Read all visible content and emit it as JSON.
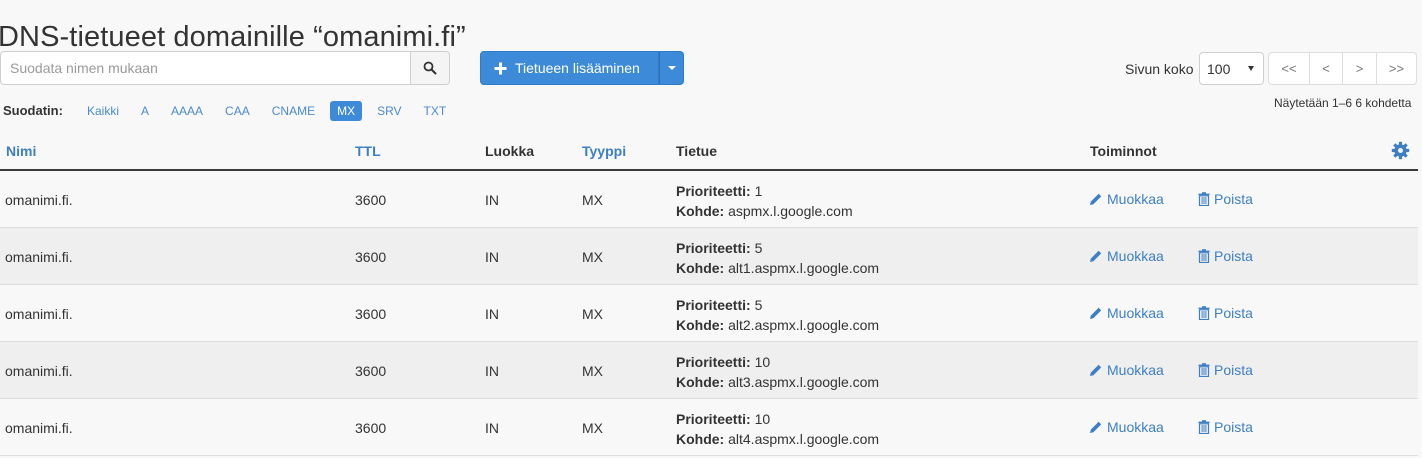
{
  "page": {
    "title": "DNS-tietueet domainille “omanimi.fi”"
  },
  "search": {
    "placeholder": "Suodata nimen mukaan",
    "value": ""
  },
  "toolbar": {
    "add_label": "Tietueen lisääminen",
    "page_size_label": "Sivun koko",
    "page_size_value": "100",
    "pager": [
      "<<",
      "<",
      ">",
      ">>"
    ],
    "showing": "Näytetään 1–6 6 kohdetta"
  },
  "filter": {
    "label": "Suodatin:",
    "options": [
      "Kaikki",
      "A",
      "AAAA",
      "CAA",
      "CNAME",
      "MX",
      "SRV",
      "TXT"
    ],
    "active": "MX"
  },
  "table": {
    "headers": {
      "name": "Nimi",
      "ttl": "TTL",
      "class": "Luokka",
      "type": "Tyyppi",
      "record": "Tietue",
      "actions": "Toiminnot"
    },
    "record_labels": {
      "priority": "Prioriteetti:",
      "target": "Kohde:"
    },
    "action_labels": {
      "edit": "Muokkaa",
      "delete": "Poista"
    },
    "rows": [
      {
        "name": "omanimi.fi.",
        "ttl": "3600",
        "class": "IN",
        "type": "MX",
        "priority": "1",
        "target": "aspmx.l.google.com"
      },
      {
        "name": "omanimi.fi.",
        "ttl": "3600",
        "class": "IN",
        "type": "MX",
        "priority": "5",
        "target": "alt1.aspmx.l.google.com"
      },
      {
        "name": "omanimi.fi.",
        "ttl": "3600",
        "class": "IN",
        "type": "MX",
        "priority": "5",
        "target": "alt2.aspmx.l.google.com"
      },
      {
        "name": "omanimi.fi.",
        "ttl": "3600",
        "class": "IN",
        "type": "MX",
        "priority": "10",
        "target": "alt3.aspmx.l.google.com"
      },
      {
        "name": "omanimi.fi.",
        "ttl": "3600",
        "class": "IN",
        "type": "MX",
        "priority": "10",
        "target": "alt4.aspmx.l.google.com"
      }
    ]
  },
  "colors": {
    "accent": "#3d8bd8",
    "link": "#3d7fc4"
  },
  "icons": {
    "search": "search-icon",
    "add": "plus-icon",
    "settings": "gear-icon",
    "edit": "pencil-icon",
    "delete": "trash-icon"
  }
}
